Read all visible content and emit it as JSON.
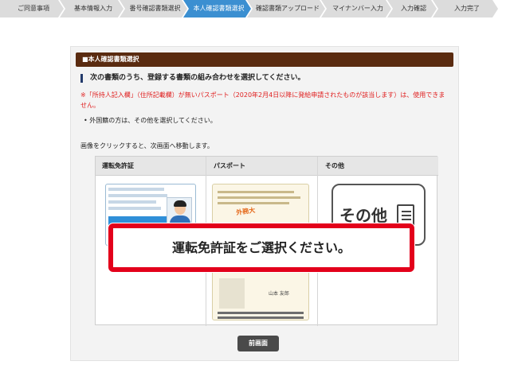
{
  "steps": [
    "ご同意事項",
    "基本情報入力",
    "番号確認書類選択",
    "本人確認書類選択",
    "確認書類アップロード",
    "マイナンバー入力",
    "入力確認",
    "入力完了"
  ],
  "active_step": 3,
  "panel": {
    "heading": "■本人確認書類選択",
    "instruction": "次の書類のうち、登録する書類の組み合わせを選択してください。",
    "notice": "※「所持人記入欄」（住所記載欄）が無いパスポート（2020年2月4日以降に発給申請されたものが該当します）は、使用できません。",
    "bullet": "• 外国籍の方は、その他を選択してください。",
    "click_hint": "画像をクリックすると、次画面へ移動します。"
  },
  "table": {
    "headers": [
      "運転免許証",
      "パスポート",
      "その他"
    ]
  },
  "cards": {
    "other_label": "その他",
    "passport_stamp": "外務大",
    "passport_name": "山本 友郎"
  },
  "overlay": {
    "message": "運転免許証をご選択ください。"
  },
  "buttons": {
    "prev": "前画面"
  },
  "colors": {
    "active_step": "#3b8fd1",
    "panel_header": "#5a2b10",
    "notice": "#e02020",
    "overlay_border": "#e3001b"
  }
}
